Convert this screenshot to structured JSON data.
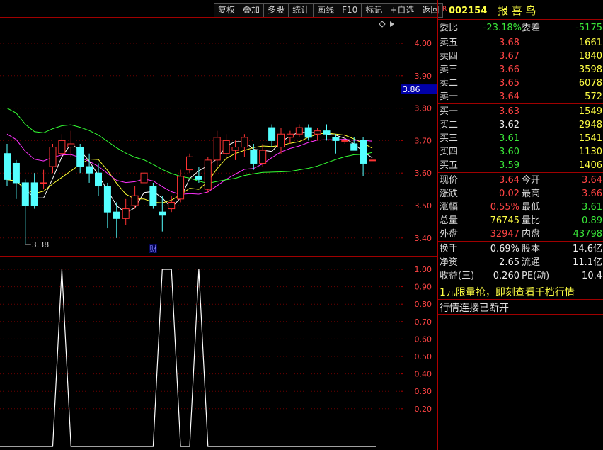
{
  "toolbar": [
    "复权",
    "叠加",
    "多股",
    "统计",
    "画线",
    "F10",
    "标记",
    "+自选",
    "返回"
  ],
  "header": {
    "badge": "R",
    "code": "002154",
    "name": "报 喜 鸟"
  },
  "main_chart": {
    "y_ticks": [
      "4.00",
      "3.90",
      "3.80",
      "3.70",
      "3.60",
      "3.50",
      "3.40"
    ],
    "price_flag": "3.86",
    "low_marker": "3.38",
    "event_marker": "财",
    "icon": "diamond-icon",
    "colors": {
      "up": "#ff3333",
      "down": "#54ffff",
      "ma1": "#ffffff",
      "ma2": "#ffff33",
      "ma3": "#ff33ff",
      "ma4": "#33ff33"
    },
    "candles": [
      [
        3.66,
        3.58,
        3.69,
        3.56
      ],
      [
        3.63,
        3.57,
        3.64,
        3.52
      ],
      [
        3.57,
        3.5,
        3.58,
        3.38
      ],
      [
        3.57,
        3.5,
        3.6,
        3.49
      ],
      [
        3.57,
        3.57,
        3.61,
        3.55
      ],
      [
        3.62,
        3.68,
        3.69,
        3.6
      ],
      [
        3.66,
        3.7,
        3.72,
        3.65
      ],
      [
        3.68,
        3.69,
        3.73,
        3.65
      ],
      [
        3.68,
        3.62,
        3.69,
        3.6
      ],
      [
        3.62,
        3.6,
        3.66,
        3.57
      ],
      [
        3.6,
        3.56,
        3.63,
        3.53
      ],
      [
        3.56,
        3.48,
        3.57,
        3.43
      ],
      [
        3.48,
        3.46,
        3.51,
        3.4
      ],
      [
        3.46,
        3.49,
        3.52,
        3.44
      ],
      [
        3.5,
        3.53,
        3.56,
        3.49
      ],
      [
        3.57,
        3.6,
        3.61,
        3.56
      ],
      [
        3.56,
        3.5,
        3.57,
        3.49
      ],
      [
        3.48,
        3.47,
        3.53,
        3.42
      ],
      [
        3.49,
        3.51,
        3.53,
        3.48
      ],
      [
        3.52,
        3.59,
        3.61,
        3.51
      ],
      [
        3.61,
        3.65,
        3.66,
        3.6
      ],
      [
        3.59,
        3.58,
        3.62,
        3.57
      ],
      [
        3.55,
        3.64,
        3.65,
        3.54
      ],
      [
        3.64,
        3.71,
        3.73,
        3.62
      ],
      [
        3.66,
        3.7,
        3.72,
        3.64
      ],
      [
        3.67,
        3.68,
        3.7,
        3.64
      ],
      [
        3.68,
        3.71,
        3.72,
        3.65
      ],
      [
        3.67,
        3.63,
        3.69,
        3.61
      ],
      [
        3.63,
        3.67,
        3.69,
        3.62
      ],
      [
        3.74,
        3.7,
        3.75,
        3.68
      ],
      [
        3.68,
        3.72,
        3.74,
        3.66
      ],
      [
        3.71,
        3.72,
        3.73,
        3.69
      ],
      [
        3.72,
        3.74,
        3.75,
        3.71
      ],
      [
        3.74,
        3.71,
        3.75,
        3.7
      ],
      [
        3.72,
        3.73,
        3.74,
        3.7
      ],
      [
        3.73,
        3.72,
        3.75,
        3.7
      ],
      [
        3.71,
        3.7,
        3.72,
        3.66
      ],
      [
        3.7,
        3.7,
        3.72,
        3.69
      ],
      [
        3.69,
        3.67,
        3.71,
        3.67
      ],
      [
        3.7,
        3.63,
        3.71,
        3.59
      ],
      [
        3.64,
        3.64,
        3.64,
        3.64
      ]
    ]
  },
  "indicator": {
    "y_ticks": [
      "1.00",
      "0.90",
      "0.80",
      "0.70",
      "0.60",
      "0.50",
      "0.40",
      "0.30",
      "0.20"
    ],
    "values": [
      0,
      0,
      0,
      0,
      0,
      0,
      1,
      0,
      0,
      0,
      0,
      0,
      0,
      0,
      0,
      0,
      0,
      1,
      1,
      0,
      0,
      1,
      0,
      0,
      0,
      0,
      0,
      0,
      0,
      0,
      0,
      0,
      0,
      0,
      0,
      0,
      0,
      0,
      0,
      0,
      0
    ]
  },
  "quote": {
    "weibi": {
      "label": "委比",
      "value": "-23.18%",
      "label2": "委差",
      "value2": "-5175"
    },
    "sells": [
      {
        "label": "卖五",
        "price": "3.68",
        "vol": "1661"
      },
      {
        "label": "卖四",
        "price": "3.67",
        "vol": "1840"
      },
      {
        "label": "卖三",
        "price": "3.66",
        "vol": "3598"
      },
      {
        "label": "卖二",
        "price": "3.65",
        "vol": "6078"
      },
      {
        "label": "卖一",
        "price": "3.64",
        "vol": "572"
      }
    ],
    "buys": [
      {
        "label": "买一",
        "price": "3.63",
        "vol": "1549",
        "color": "red"
      },
      {
        "label": "买二",
        "price": "3.62",
        "vol": "2948",
        "color": "white"
      },
      {
        "label": "买三",
        "price": "3.61",
        "vol": "1541",
        "color": "green"
      },
      {
        "label": "买四",
        "price": "3.60",
        "vol": "1130",
        "color": "green"
      },
      {
        "label": "买五",
        "price": "3.59",
        "vol": "1406",
        "color": "green"
      }
    ],
    "stats": [
      {
        "l1": "现价",
        "v1": "3.64",
        "c1": "red",
        "l2": "今开",
        "v2": "3.64",
        "c2": "red"
      },
      {
        "l1": "涨跌",
        "v1": "0.02",
        "c1": "red",
        "l2": "最高",
        "v2": "3.66",
        "c2": "red"
      },
      {
        "l1": "涨幅",
        "v1": "0.55%",
        "c1": "red",
        "l2": "最低",
        "v2": "3.61",
        "c2": "green"
      },
      {
        "l1": "总量",
        "v1": "76745",
        "c1": "yellow",
        "l2": "量比",
        "v2": "0.89",
        "c2": "green"
      },
      {
        "l1": "外盘",
        "v1": "32947",
        "c1": "red",
        "l2": "内盘",
        "v2": "43798",
        "c2": "green"
      }
    ],
    "fin": [
      {
        "l1": "换手",
        "v1": "0.69%",
        "l2": "股本",
        "v2": "14.6亿"
      },
      {
        "l1": "净资",
        "v1": "2.65",
        "l2": "流通",
        "v2": "11.1亿"
      },
      {
        "l1": "收益(三)",
        "v1": "0.260",
        "l2": "PE(动)",
        "v2": "10.4"
      }
    ],
    "promo": "1元限量抢，即刻查看千档行情",
    "status": "行情连接已断开"
  }
}
